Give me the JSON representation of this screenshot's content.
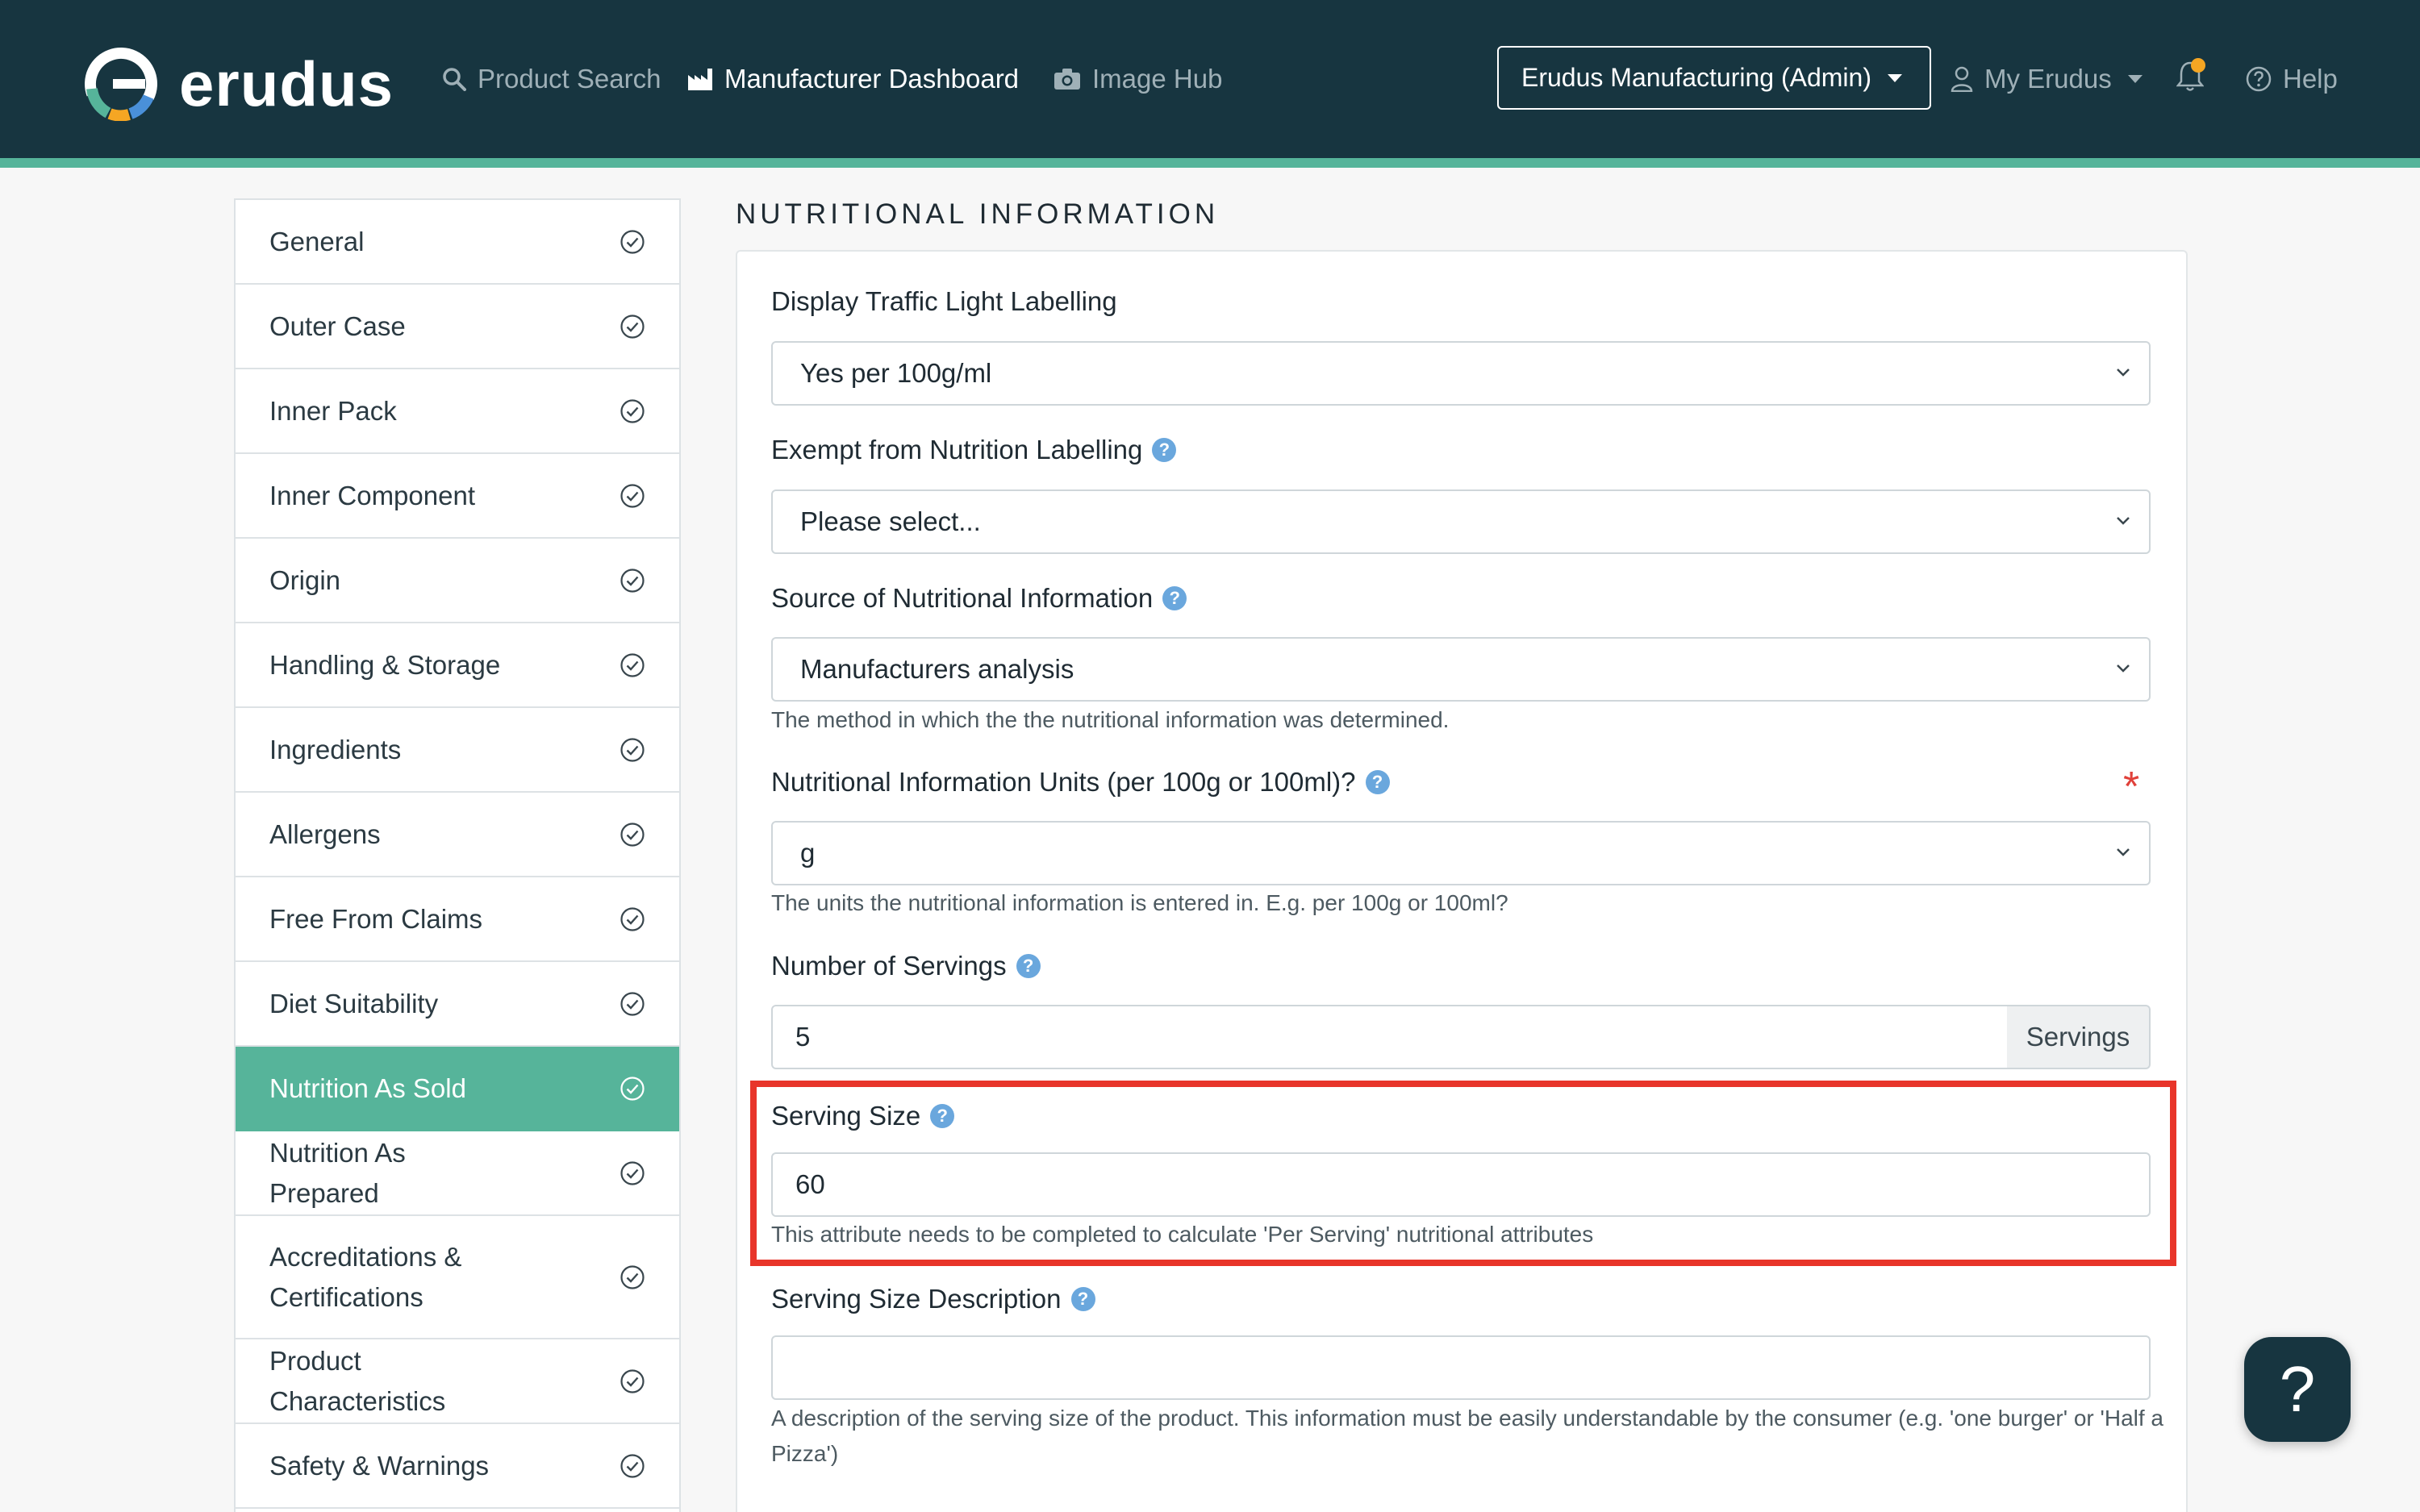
{
  "header": {
    "logo_text": "erudus",
    "nav": {
      "product_search": "Product Search",
      "manufacturer_dashboard": "Manufacturer Dashboard",
      "image_hub": "Image Hub"
    },
    "company_selector": "Erudus Manufacturing (Admin)",
    "my_erudus": "My Erudus",
    "help": "Help",
    "colors": {
      "bar": "#173540",
      "accent": "#56b49a",
      "notification": "#f5a623"
    }
  },
  "sidebar": {
    "items": [
      {
        "label": "General"
      },
      {
        "label": "Outer Case"
      },
      {
        "label": "Inner Pack"
      },
      {
        "label": "Inner Component"
      },
      {
        "label": "Origin"
      },
      {
        "label": "Handling & Storage"
      },
      {
        "label": "Ingredients"
      },
      {
        "label": "Allergens"
      },
      {
        "label": "Free From Claims"
      },
      {
        "label": "Diet Suitability"
      },
      {
        "label": "Nutrition As Sold",
        "active": true
      },
      {
        "label": "Nutrition As Prepared"
      },
      {
        "label": "Accreditations & Certifications"
      },
      {
        "label": "Product Characteristics"
      },
      {
        "label": "Safety & Warnings"
      }
    ],
    "check_icon": "check-circle-icon"
  },
  "main": {
    "section_title": "NUTRITIONAL INFORMATION",
    "fields": {
      "traffic_light": {
        "label": "Display Traffic Light Labelling",
        "value": "Yes per 100g/ml"
      },
      "exempt": {
        "label": "Exempt from Nutrition Labelling",
        "value": "Please select..."
      },
      "source": {
        "label": "Source of Nutritional Information",
        "value": "Manufacturers analysis",
        "help": "The method in which the the nutritional information was determined."
      },
      "units": {
        "label": "Nutritional Information Units (per 100g or 100ml)?",
        "value": "g",
        "help": "The units the nutritional information is entered in. E.g. per 100g or 100ml?",
        "required_mark": "*"
      },
      "servings": {
        "label": "Number of Servings",
        "value": "5",
        "addon": "Servings"
      },
      "serving_size": {
        "label": "Serving Size",
        "value": "60",
        "help": "This attribute needs to be completed to calculate 'Per Serving' nutritional attributes"
      },
      "serving_desc": {
        "label": "Serving Size Description",
        "value": "",
        "help": "A description of the serving size of the product. This information must be easily understandable by the consumer (e.g. 'one burger' or 'Half a Pizza')"
      }
    },
    "help_glyph": "?"
  },
  "help_fab": {
    "glyph": "?"
  }
}
